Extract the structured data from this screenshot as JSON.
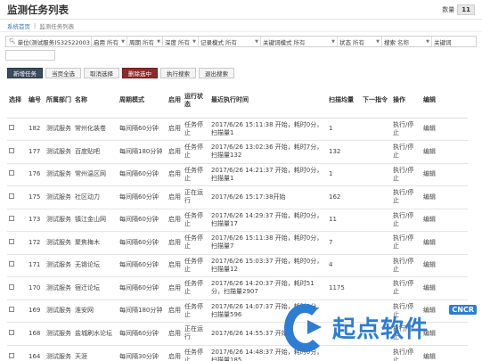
{
  "header": {
    "title": "监测任务列表",
    "count_label": "数量",
    "count": "11"
  },
  "breadcrumb": {
    "home": "系统首页",
    "current": "监测任务列表"
  },
  "filters": {
    "unit_search": "单位(测试服务)532522003",
    "selects": [
      {
        "label": "启用",
        "value": "所有"
      },
      {
        "label": "周期",
        "value": "所有"
      },
      {
        "label": "深度",
        "value": "所有"
      },
      {
        "label": "记录模式",
        "value": "所有"
      },
      {
        "label": "关键词模式",
        "value": "所有"
      },
      {
        "label": "状态",
        "value": "所有"
      },
      {
        "label": "搜索",
        "value": "名称"
      },
      {
        "label": "关键词",
        "value": ""
      }
    ]
  },
  "toolbar": {
    "new_task": "新增任务",
    "select_all": "当页全选",
    "deselect": "取消选择",
    "delete_selected": "删除选中",
    "run_search": "执行搜索",
    "exit_search": "退出搜索"
  },
  "table": {
    "headers": [
      "选择",
      "编号",
      "所属部门",
      "名称",
      "周期模式",
      "启用",
      "运行状态",
      "最近执行时间",
      "扫描均量",
      "下一指令",
      "操作",
      "编辑"
    ],
    "rows": [
      {
        "id": "182",
        "dept": "测试服务",
        "name": "常州化装卷",
        "cycle": "每间隔60分钟",
        "enabled": "启用",
        "status": "任务停止",
        "status_type": "stopped",
        "last_run": "2017/6/26 15:11:38 开始，耗时0分，扫描量1",
        "scan": "1",
        "scan_red": true,
        "op": "执行/停止",
        "edit": "编辑"
      },
      {
        "id": "177",
        "dept": "测试服务",
        "name": "百度贴吧",
        "cycle": "每间隔180分钟",
        "enabled": "启用",
        "status": "任务停止",
        "status_type": "stopped",
        "last_run": "2017/6/26 13:02:36 开始，耗时7分，扫描量132",
        "scan": "132",
        "scan_red": false,
        "op": "执行/停止",
        "edit": "编辑"
      },
      {
        "id": "176",
        "dept": "测试服务",
        "name": "常州温区网",
        "cycle": "每间隔60分钟",
        "enabled": "启用",
        "status": "任务停止",
        "status_type": "stopped",
        "last_run": "2017/6/26 14:21:37 开始，耗时0分，扫描量1",
        "scan": "1",
        "scan_red": true,
        "op": "执行/停止",
        "edit": "编辑"
      },
      {
        "id": "175",
        "dept": "测试服务",
        "name": "社区动力",
        "cycle": "每间隔60分钟",
        "enabled": "启用",
        "status": "正在运行",
        "status_type": "running",
        "last_run": "2017/6/26 15:17:38开始",
        "scan": "162",
        "scan_red": false,
        "op": "执行/停止",
        "edit": "编辑"
      },
      {
        "id": "173",
        "dept": "测试服务",
        "name": "镇江金山网",
        "cycle": "每间隔60分钟",
        "enabled": "启用",
        "status": "任务停止",
        "status_type": "stopped",
        "last_run": "2017/6/26 14:29:37 开始，耗时0分，扫描量17",
        "scan": "11",
        "scan_red": false,
        "op": "执行/停止",
        "edit": "编辑"
      },
      {
        "id": "172",
        "dept": "测试服务",
        "name": "聚焦梅木",
        "cycle": "每间隔60分钟",
        "enabled": "启用",
        "status": "任务停止",
        "status_type": "stopped",
        "last_run": "2017/6/26 15:11:38 开始，耗时0分，扫描量7",
        "scan": "7",
        "scan_red": true,
        "op": "执行/停止",
        "edit": "编辑"
      },
      {
        "id": "171",
        "dept": "测试服务",
        "name": "无锡论坛",
        "cycle": "每间隔60分钟",
        "enabled": "启用",
        "status": "任务停止",
        "status_type": "stopped",
        "last_run": "2017/6/26 15:03:37 开始，耗时0分，扫描量12",
        "scan": "4",
        "scan_red": true,
        "op": "执行/停止",
        "edit": "编辑"
      },
      {
        "id": "170",
        "dept": "测试服务",
        "name": "宿迁论坛",
        "cycle": "每间隔60分钟",
        "enabled": "启用",
        "status": "任务停止",
        "status_type": "stopped",
        "last_run": "2017/6/26 14:20:37 开始，耗时51分，扫描量2907",
        "scan": "1175",
        "scan_red": false,
        "op": "执行/停止",
        "edit": "编辑"
      },
      {
        "id": "169",
        "dept": "测试服务",
        "name": "淮安网",
        "cycle": "每间隔180分钟",
        "enabled": "启用",
        "status": "任务停止",
        "status_type": "stopped",
        "last_run": "2017/6/26 14:07:37 开始，耗时0分，扫描量596",
        "scan": "",
        "scan_red": false,
        "op": "执行/停止",
        "edit": "编辑"
      },
      {
        "id": "168",
        "dept": "测试服务",
        "name": "盐城刷水论坛",
        "cycle": "每间隔60分钟",
        "enabled": "启用",
        "status": "正在运行",
        "status_type": "running",
        "last_run": "2017/6/26 14:55:37 开始",
        "scan": "",
        "scan_red": false,
        "op": "执行/停止",
        "edit": "编辑"
      },
      {
        "id": "164",
        "dept": "测试服务",
        "name": "天涯",
        "cycle": "每间隔30分钟",
        "enabled": "启用",
        "status": "任务停止",
        "status_type": "stopped",
        "last_run": "2017/6/26 14:48:37 开始，耗时0分，扫描量185",
        "scan": "",
        "scan_red": false,
        "op": "执行/停止",
        "edit": "编辑"
      }
    ]
  },
  "watermark": {
    "text": "起点软件",
    "badge": "CNCR"
  },
  "colors": {
    "link": "#3a70b8",
    "stopped": "#2f9a2f",
    "running": "#c0392b",
    "primary_button": "#3b4a5c",
    "danger_button": "#8b2b2b"
  }
}
